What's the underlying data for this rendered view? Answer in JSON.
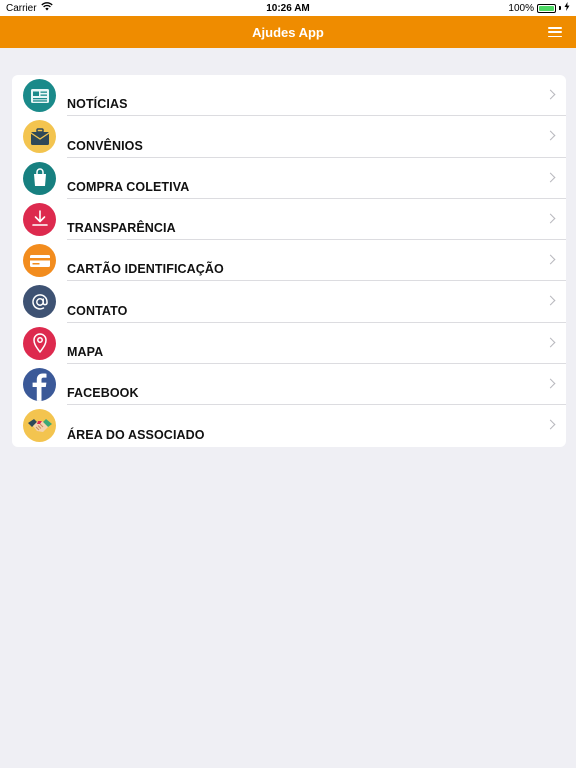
{
  "status_bar": {
    "carrier": "Carrier",
    "time": "10:26 AM",
    "battery_percent": "100%",
    "battery_level": 1.0
  },
  "nav": {
    "title": "Ajudes App",
    "menu_icon": "hamburger-menu-icon"
  },
  "menu": {
    "items": [
      {
        "label": "NOTÍCIAS",
        "icon": "newspaper-icon",
        "color": "#1a8a8a"
      },
      {
        "label": "CONVÊNIOS",
        "icon": "briefcase-icon",
        "color": "#f3c44f"
      },
      {
        "label": "COMPRA COLETIVA",
        "icon": "shopping-bag-icon",
        "color": "#178080"
      },
      {
        "label": "TRANSPARÊNCIA",
        "icon": "download-icon",
        "color": "#dd2a4e"
      },
      {
        "label": "CARTÃO IDENTIFICAÇÃO",
        "icon": "credit-card-icon",
        "color": "#f28c1e"
      },
      {
        "label": "CONTATO",
        "icon": "at-sign-icon",
        "color": "#3e5273"
      },
      {
        "label": "MAPA",
        "icon": "map-pin-icon",
        "color": "#dd2a4e"
      },
      {
        "label": "FACEBOOK",
        "icon": "facebook-icon",
        "color": "#3b5998"
      },
      {
        "label": "ÁREA DO ASSOCIADO",
        "icon": "handshake-icon",
        "color": "#f3c44f"
      }
    ]
  },
  "colors": {
    "accent": "#ef8c00",
    "background": "#efeff4"
  }
}
